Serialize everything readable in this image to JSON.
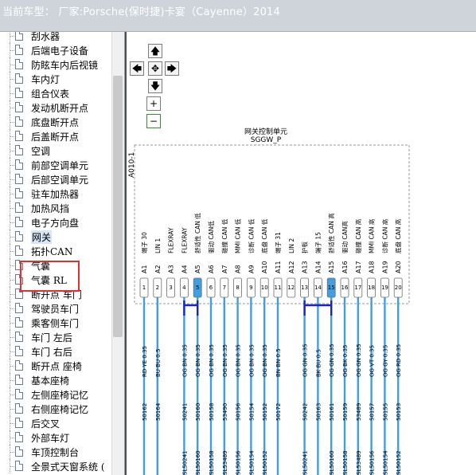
{
  "header": {
    "title": "当前车型：  厂家:Porsche(保时捷)卡宴（Cayenne）2014"
  },
  "tree": {
    "items": [
      {
        "label": "刮水器",
        "selected": false
      },
      {
        "label": "后端电子设备",
        "selected": false
      },
      {
        "label": "防眩车内后视镜",
        "selected": false
      },
      {
        "label": "车内灯",
        "selected": false
      },
      {
        "label": "组合仪表",
        "selected": false
      },
      {
        "label": "发动机断开点",
        "selected": false
      },
      {
        "label": "底盘断开点",
        "selected": false
      },
      {
        "label": "后盖断开点",
        "selected": false
      },
      {
        "label": "空调",
        "selected": false
      },
      {
        "label": "前部空调单元",
        "selected": false
      },
      {
        "label": "后部空调单元",
        "selected": false
      },
      {
        "label": "驻车加热器",
        "selected": false
      },
      {
        "label": "加热风挡",
        "selected": false
      },
      {
        "label": "电子方向盘",
        "selected": false
      },
      {
        "label": "网关",
        "selected": true
      },
      {
        "label": "拓扑CAN",
        "selected": false
      },
      {
        "label": "气囊",
        "selected": false
      },
      {
        "label": "气囊 RL",
        "selected": false
      },
      {
        "label": "断开点 车门",
        "selected": false
      },
      {
        "label": "驾驶员车门",
        "selected": false
      },
      {
        "label": "乘客侧车门",
        "selected": false
      },
      {
        "label": "车门 左后",
        "selected": false
      },
      {
        "label": "车门 右后",
        "selected": false
      },
      {
        "label": "断开点 座椅",
        "selected": false
      },
      {
        "label": "基本座椅",
        "selected": false
      },
      {
        "label": "左侧座椅记忆",
        "selected": false
      },
      {
        "label": "右侧座椅记忆",
        "selected": false
      },
      {
        "label": "后交叉",
        "selected": false
      },
      {
        "label": "外部车灯",
        "selected": false
      },
      {
        "label": "车顶控制台",
        "selected": false
      },
      {
        "label": "全景式天窗系统 (",
        "selected": false
      }
    ]
  },
  "toolbar": {
    "pan_up": "🡅",
    "pan_left": "🡄",
    "pan_center": "✥",
    "pan_right": "🡆",
    "pan_down": "🡇",
    "zoom_in": "+",
    "zoom_out": "−"
  },
  "diagram": {
    "unit_title": "网关控制单元",
    "unit_code": "SGGW_P",
    "connector_id": "A010-1",
    "pins": [
      {
        "num": "1",
        "pin": "A1",
        "func": "端子 30",
        "wire": "RD YE 0.35",
        "code": "50162",
        "sl": "",
        "color": "#3f9fe0",
        "bus": "",
        "bluefill": false
      },
      {
        "num": "2",
        "pin": "A2",
        "func": "LIN 1",
        "wire": "BU BU 0.5",
        "code": "50164",
        "sl": "",
        "color": "#3f9fe0",
        "bus": "",
        "bluefill": false
      },
      {
        "num": "3",
        "pin": "A3",
        "func": "FLEXRAY",
        "wire": "",
        "code": "",
        "sl": "",
        "color": "",
        "bus": "",
        "bluefill": false
      },
      {
        "num": "4",
        "pin": "A4",
        "func": "FLEXRAY",
        "wire": "OG BN 0.35",
        "code": "50241",
        "sl": "SL50241",
        "color": "#3f9fe0",
        "bus": "a",
        "bluefill": false
      },
      {
        "num": "5",
        "pin": "A5",
        "func": "舒适性 CAN 低",
        "wire": "OG BN 0.35",
        "code": "50160",
        "sl": "SL50160",
        "color": "#3f9fe0",
        "bus": "a",
        "bluefill": true
      },
      {
        "num": "6",
        "pin": "A6",
        "func": "驱动 CAN低",
        "wire": "OG BN 0.35",
        "code": "50158",
        "sl": "SL50158",
        "color": "#3f9fe0",
        "bus": "",
        "bluefill": false
      },
      {
        "num": "7",
        "pin": "A7",
        "func": "碰撞 CAN 低",
        "wire": "OG BN 0.35",
        "code": "53490",
        "sl": "SL53489",
        "color": "#3f9fe0",
        "bus": "",
        "bluefill": false
      },
      {
        "num": "8",
        "pin": "A8",
        "func": "MMI CAN 低",
        "wire": "OG BN 0.35",
        "code": "50156",
        "sl": "SL50156",
        "color": "#3f9fe0",
        "bus": "",
        "bluefill": false
      },
      {
        "num": "9",
        "pin": "A9",
        "func": "诊断 CAN 低",
        "wire": "OG BN 0.35",
        "code": "50154",
        "sl": "SL50154",
        "color": "#3f9fe0",
        "bus": "",
        "bluefill": false
      },
      {
        "num": "10",
        "pin": "A10",
        "func": "底盘 CAN 低",
        "wire": "OG BN 0.35",
        "code": "50152",
        "sl": "SL50152",
        "color": "#3f9fe0",
        "bus": "",
        "bluefill": false
      },
      {
        "num": "11",
        "pin": "A11",
        "func": "端子 31",
        "wire": "BN BN 0.5",
        "code": "50172",
        "sl": "",
        "color": "#3f9fe0",
        "bus": "",
        "bluefill": false
      },
      {
        "num": "12",
        "pin": "A12",
        "func": "LIN 2",
        "wire": "",
        "code": "",
        "sl": "",
        "color": "",
        "bus": "",
        "bluefill": false
      },
      {
        "num": "13",
        "pin": "A13",
        "func": "护板",
        "wire": "OG GN 0.35",
        "code": "50242",
        "sl": "SL50241",
        "color": "#3f9fe0",
        "bus": "b",
        "bluefill": false
      },
      {
        "num": "14",
        "pin": "A14",
        "func": "端子 15",
        "wire": "BK BU 0.5",
        "code": "50163",
        "sl": "",
        "color": "#3f9fe0",
        "bus": "",
        "bluefill": false
      },
      {
        "num": "15",
        "pin": "A15",
        "func": "舒适性 CAN 高",
        "wire": "OG GN 0.35",
        "code": "50161",
        "sl": "SL50160",
        "color": "#3f9fe0",
        "bus": "b",
        "bluefill": true
      },
      {
        "num": "16",
        "pin": "A16",
        "func": "驱动 CAN高",
        "wire": "OG BK 0.35",
        "code": "50159",
        "sl": "SL50158",
        "color": "#3f9fe0",
        "bus": "",
        "bluefill": false
      },
      {
        "num": "17",
        "pin": "A17",
        "func": "碰撞 CAN 高",
        "wire": "OG GN 0.35",
        "code": "53489",
        "sl": "SL53489",
        "color": "#3f9fe0",
        "bus": "",
        "bluefill": false
      },
      {
        "num": "18",
        "pin": "A18",
        "func": "MMI CAN 高",
        "wire": "OG VT 0.35",
        "code": "50157",
        "sl": "SL50156",
        "color": "#3f9fe0",
        "bus": "",
        "bluefill": false
      },
      {
        "num": "19",
        "pin": "A19",
        "func": "诊断 CAN 高",
        "wire": "OG GY 0.35",
        "code": "50155",
        "sl": "SL50154",
        "color": "#3f9fe0",
        "bus": "",
        "bluefill": false
      },
      {
        "num": "20",
        "pin": "A20",
        "func": "底盘 CAN 高",
        "wire": "OG RD 0.35",
        "code": "50153",
        "sl": "SL50152",
        "color": "#3f9fe0",
        "bus": "",
        "bluefill": false
      }
    ]
  }
}
